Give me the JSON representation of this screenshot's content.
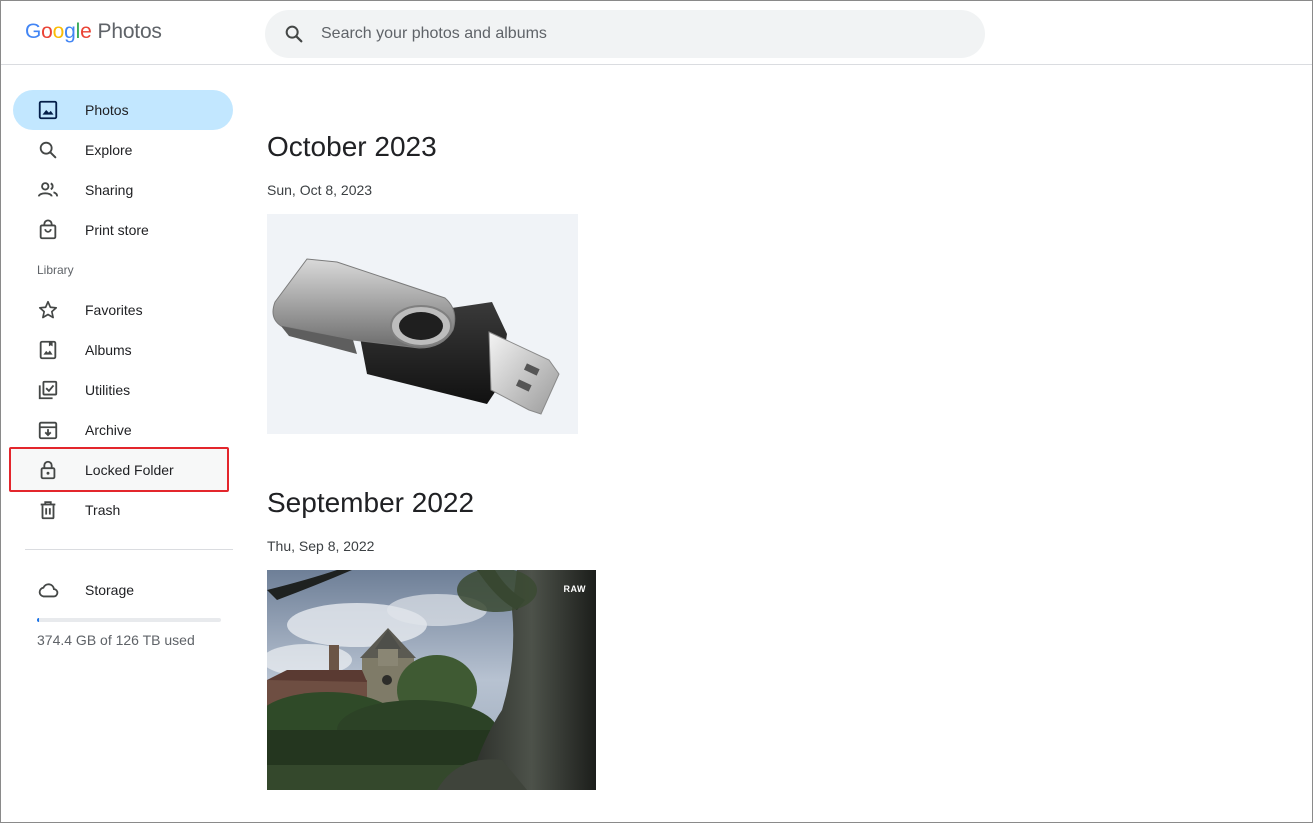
{
  "app": {
    "logo_letters": [
      "G",
      "o",
      "o",
      "g",
      "l",
      "e"
    ],
    "product_name": "Photos"
  },
  "search": {
    "placeholder": "Search your photos and albums",
    "icon": "search-icon"
  },
  "sidebar": {
    "items": [
      {
        "label": "Photos",
        "icon": "photo-icon",
        "active": true
      },
      {
        "label": "Explore",
        "icon": "search-icon"
      },
      {
        "label": "Sharing",
        "icon": "people-icon"
      },
      {
        "label": "Print store",
        "icon": "shopping-bag-icon"
      }
    ],
    "library_label": "Library",
    "library_items": [
      {
        "label": "Favorites",
        "icon": "star-icon"
      },
      {
        "label": "Albums",
        "icon": "album-icon"
      },
      {
        "label": "Utilities",
        "icon": "checklist-icon"
      },
      {
        "label": "Archive",
        "icon": "archive-icon"
      },
      {
        "label": "Locked Folder",
        "icon": "lock-icon",
        "highlighted": true
      },
      {
        "label": "Trash",
        "icon": "trash-icon"
      }
    ],
    "storage": {
      "label": "Storage",
      "icon": "cloud-icon",
      "usage_text": "374.4 GB of 126 TB used",
      "used_fraction": 0.003
    }
  },
  "timeline": [
    {
      "month": "October 2023",
      "date": "Sun, Oct 8, 2023",
      "photos": [
        {
          "subject": "usb-drive",
          "badge": ""
        }
      ]
    },
    {
      "month": "September 2022",
      "date": "Thu, Sep 8, 2022",
      "photos": [
        {
          "subject": "church-landscape",
          "badge": "RAW"
        }
      ]
    }
  ],
  "colors": {
    "active_nav_bg": "#c2e7ff",
    "highlight_border": "#e3262c",
    "search_bg": "#f1f3f4"
  }
}
